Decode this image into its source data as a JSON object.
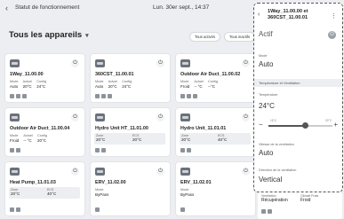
{
  "header": {
    "back_icon": "chevron-left-icon",
    "status_label": "Statut de fonctionnement",
    "datetime": "Lun. 30er sept., 14:37"
  },
  "main": {
    "title": "Tous les appareils",
    "filters": [
      "Tous activés",
      "Tous inactifs"
    ]
  },
  "cards": [
    {
      "name": "1Way_11.00.00",
      "l1": "Mode",
      "v1": "Auto",
      "l2": "Actuel",
      "v2": "20°C",
      "l3": "Config",
      "v3": "24°C"
    },
    {
      "name": "360CST_11.00.01",
      "l1": "Mode",
      "v1": "Auto",
      "l2": "Actuel",
      "v2": "20°C",
      "l3": "Config",
      "v3": "24°C"
    },
    {
      "name": "Outdoor Air Duct_11.00.02",
      "l1": "Mode",
      "v1": "Froid",
      "l2": "Actuel",
      "v2": "-- °C",
      "l3": "Config",
      "v3": "--°C"
    },
    {
      "name": "Outdoor Air Duct_11.00.04",
      "l1": "Mode",
      "v1": "Froid",
      "l2": "Actuel",
      "v2": "-- °C",
      "l3": "Config",
      "v3": "20°C"
    },
    {
      "name": "Hydro Unit HT_11.01.00",
      "l1": "Zone",
      "v1": "20°C",
      "l2": "ECS",
      "v2": "20°C",
      "l3": "",
      "v3": ""
    },
    {
      "name": "Hydro Unit_11.01.01",
      "l1": "Zone",
      "v1": "20°C",
      "l2": "ECS",
      "v2": "40°C",
      "l3": "",
      "v3": ""
    },
    {
      "name": "Heat Pump_11.01.03",
      "l1": "Zone",
      "v1": "20°C",
      "l2": "ECS",
      "v2": "40°C",
      "l3": "",
      "v3": ""
    },
    {
      "name": "ERV_11.02.00",
      "l1": "Mode",
      "v1": "ByPass",
      "l2": "",
      "v2": "",
      "l3": "",
      "v3": ""
    },
    {
      "name": "ERV_11.02.01",
      "l1": "Mode",
      "v1": "ByPass",
      "l2": "",
      "v2": "",
      "l3": "",
      "v3": ""
    }
  ],
  "panel": {
    "title_line1": "1Way_11.00.00 et",
    "title_line2": "360CST_11.00.01",
    "state": "Actif",
    "mode_label": "Mode",
    "mode_value": "Auto",
    "section_label": "Température et Ventilation",
    "temp_label": "Température",
    "temp_value": "24°C",
    "slider_min": "16°C",
    "slider_max": "30°C",
    "slider_value": 24,
    "fan_label": "Vitesse de la ventilation",
    "fan_value": "Auto",
    "dir_label": "Direction de la ventilation",
    "dir_value": "Vertical"
  },
  "peek": {
    "l1": "Ventilation",
    "v1": "Récupération",
    "l2": "Climatt Frais",
    "v2": "Froid"
  }
}
